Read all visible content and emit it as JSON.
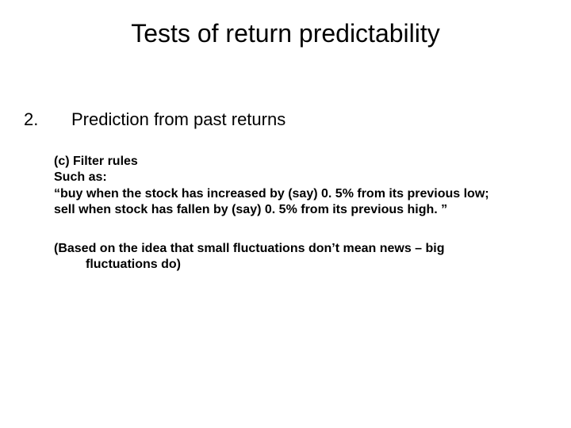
{
  "title": "Tests of return predictability",
  "item": {
    "number": "2.",
    "heading": "Prediction from past returns"
  },
  "body": {
    "l1": "(c)  Filter rules",
    "l2": "Such as:",
    "l3": "“buy when the stock has increased by (say) 0. 5% from its previous low;",
    "l4": "sell when stock has fallen by (say) 0. 5% from its previous high. ”"
  },
  "paren": {
    "l1": "(Based on the idea that small fluctuations don’t mean news – big",
    "l2": "fluctuations do)"
  }
}
